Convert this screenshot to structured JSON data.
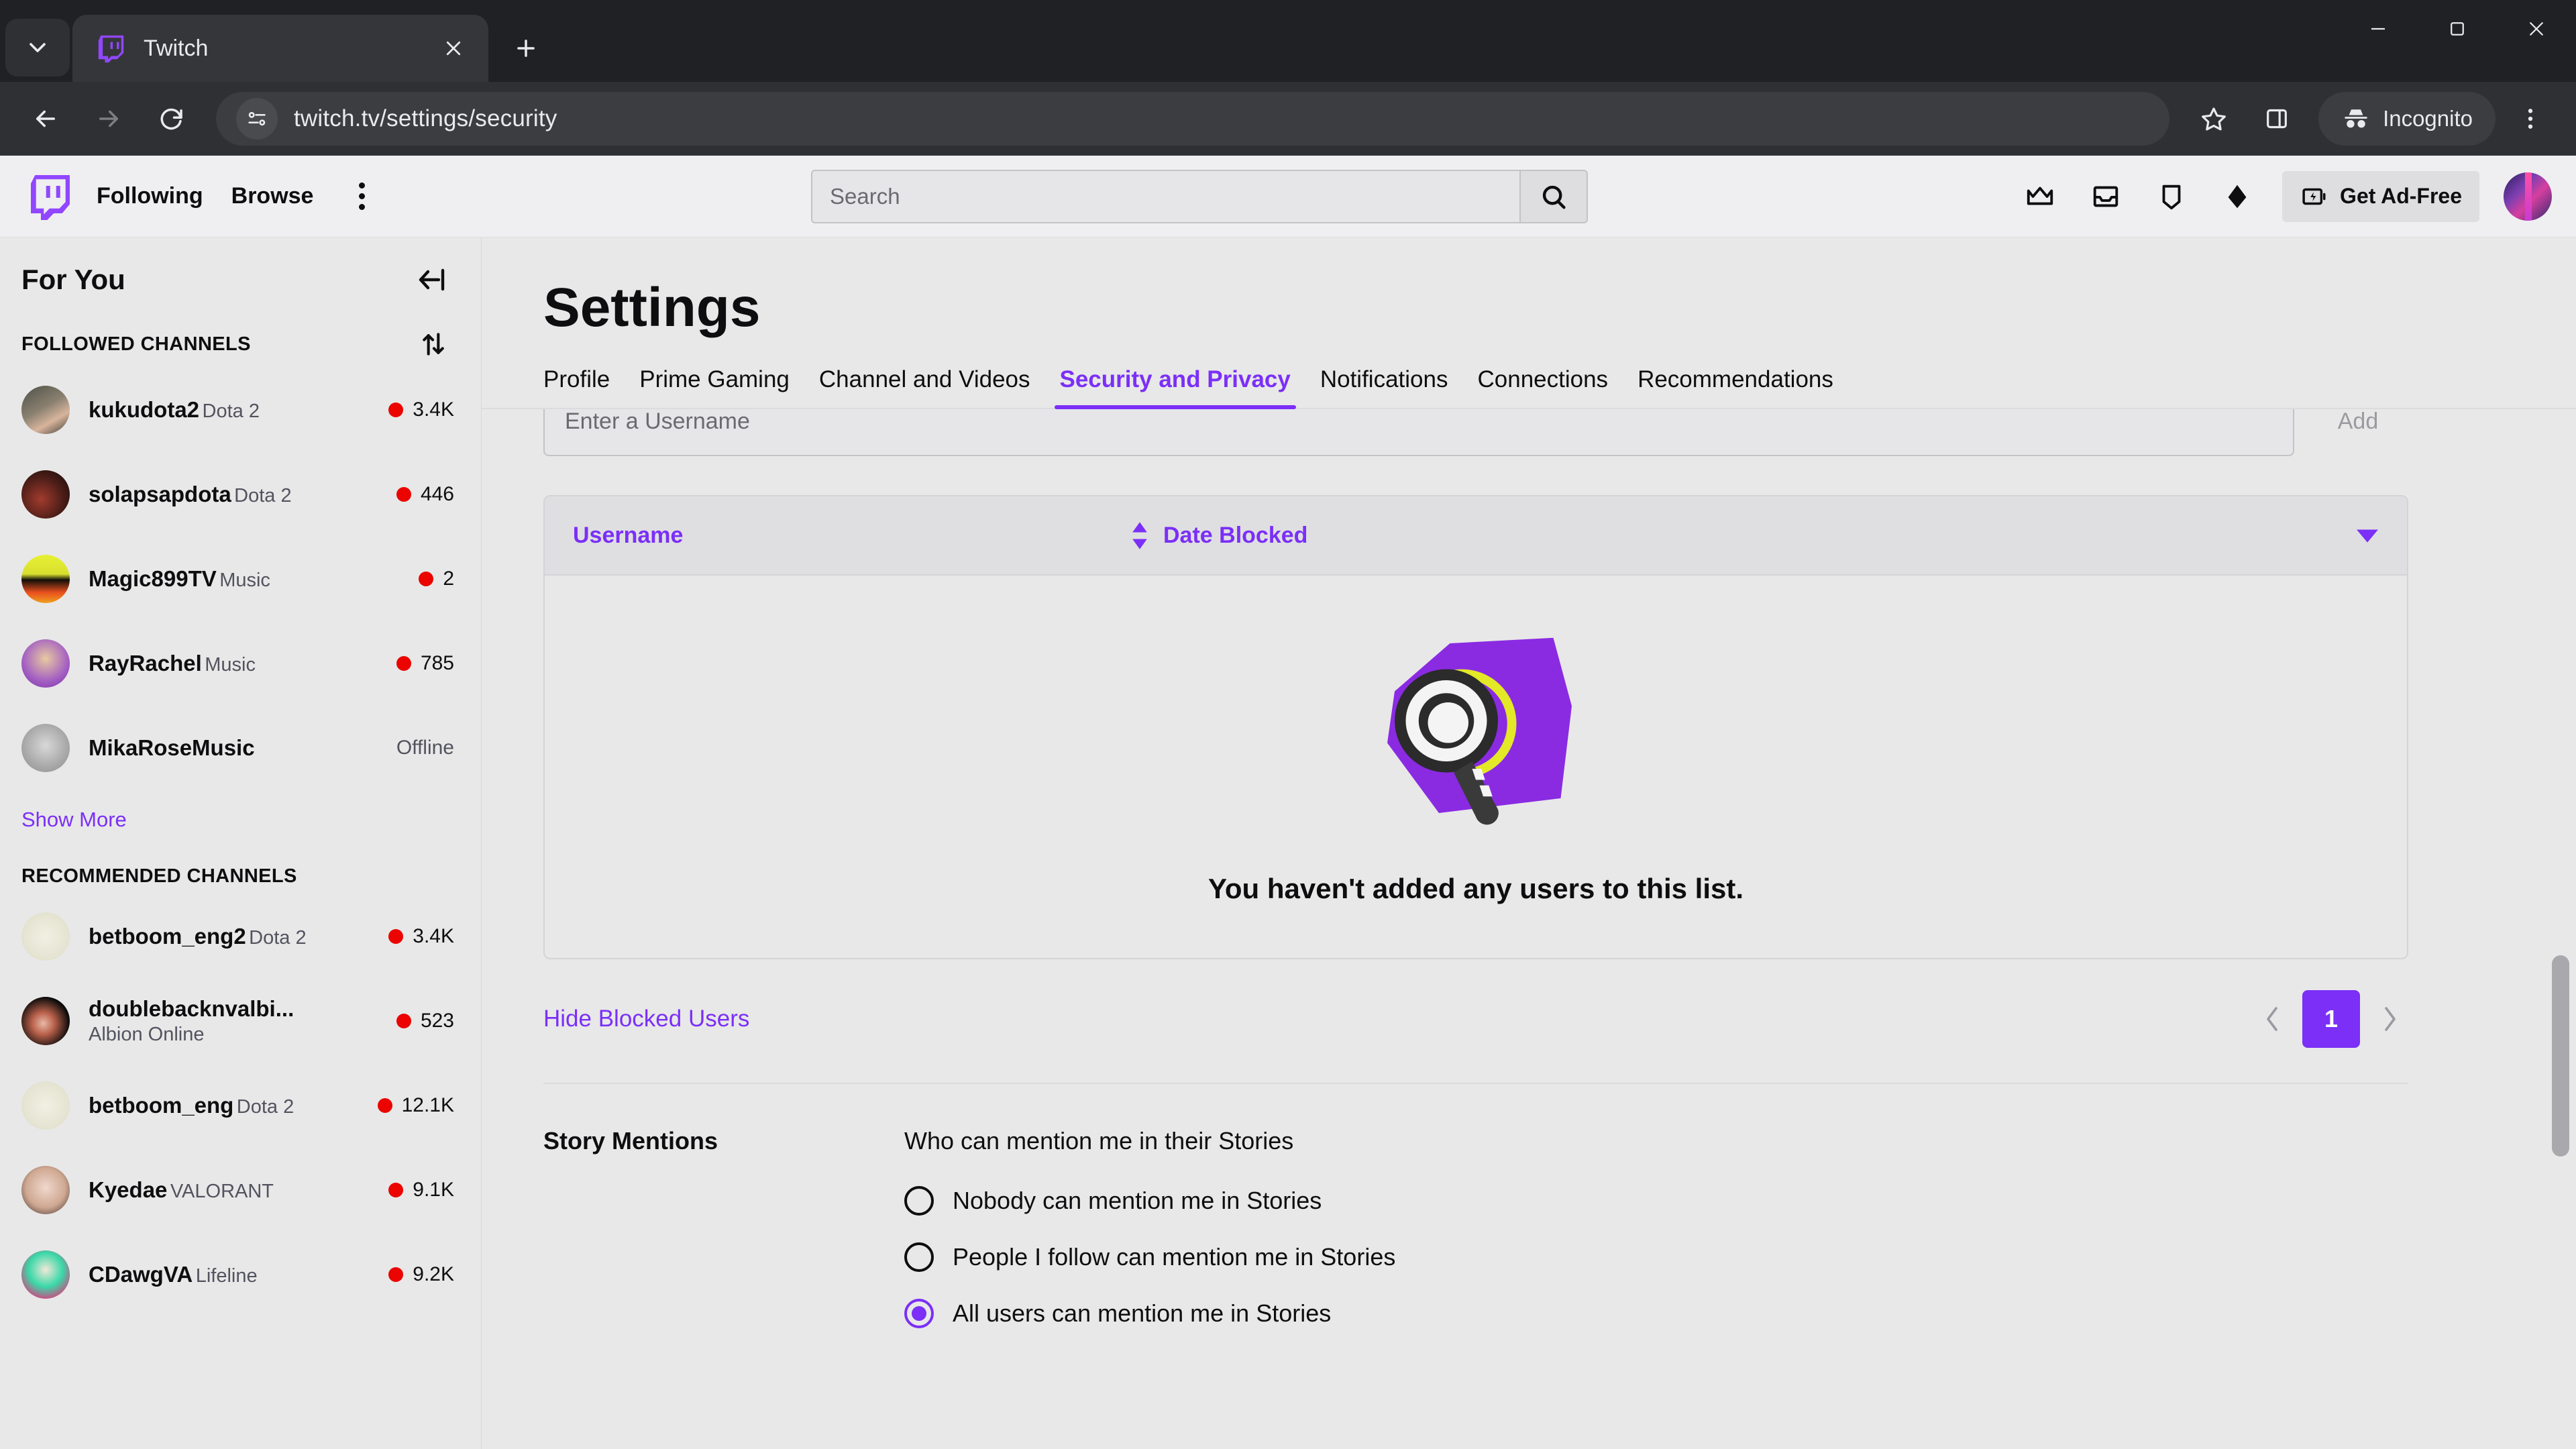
{
  "browser": {
    "tab": {
      "title": "Twitch",
      "favicon": "twitch-favicon"
    },
    "tab_search_label": "Search tabs",
    "new_tab_label": "New Tab",
    "window": {
      "minimize": "Minimize",
      "maximize": "Maximize",
      "close": "Close"
    },
    "nav": {
      "back": "Back",
      "forward": "Forward",
      "reload": "Reload"
    },
    "omnibox": {
      "url": "twitch.tv/settings/security",
      "site_info": "site-info-icon"
    },
    "actions": {
      "bookmark": "Bookmark this tab",
      "side_panel": "Side panel",
      "menu": "Customize and control"
    },
    "incognito_label": "Incognito"
  },
  "twitch_nav": {
    "logo": "twitch-logo",
    "links": [
      "Following",
      "Browse"
    ],
    "more_label": "More",
    "search": {
      "placeholder": "Search",
      "value": "",
      "button_label": "Search"
    },
    "icons": [
      "crown-icon",
      "inbox-icon",
      "whispers-icon",
      "bits-icon"
    ],
    "ad_free": {
      "label": "Get Ad-Free"
    },
    "avatar_label": "User avatar"
  },
  "sidebar": {
    "title": "For You",
    "collapse_label": "Collapse",
    "followed": {
      "heading": "FOLLOWED CHANNELS",
      "sort_label": "Sort",
      "channels": [
        {
          "name": "kukudota2",
          "category": "Dota 2",
          "viewers": "3.4K",
          "live": true,
          "status": ""
        },
        {
          "name": "solapsapdota",
          "category": "Dota 2",
          "viewers": "446",
          "live": true,
          "status": ""
        },
        {
          "name": "Magic899TV",
          "category": "Music",
          "viewers": "2",
          "live": true,
          "status": ""
        },
        {
          "name": "RayRachel",
          "category": "Music",
          "viewers": "785",
          "live": true,
          "status": ""
        },
        {
          "name": "MikaRoseMusic",
          "category": "",
          "viewers": "",
          "live": false,
          "status": "Offline"
        }
      ],
      "show_more": "Show More"
    },
    "recommended": {
      "heading": "RECOMMENDED CHANNELS",
      "channels": [
        {
          "name": "betboom_eng2",
          "category": "Dota 2",
          "viewers": "3.4K",
          "live": true
        },
        {
          "name": "doublebacknvalbi...",
          "category": "Albion Online",
          "viewers": "523",
          "live": true
        },
        {
          "name": "betboom_eng",
          "category": "Dota 2",
          "viewers": "12.1K",
          "live": true
        },
        {
          "name": "Kyedae",
          "category": "VALORANT",
          "viewers": "9.1K",
          "live": true
        },
        {
          "name": "CDawgVA",
          "category": "Lifeline",
          "viewers": "9.2K",
          "live": true
        }
      ]
    }
  },
  "settings": {
    "title": "Settings",
    "tabs": [
      {
        "label": "Profile",
        "active": false
      },
      {
        "label": "Prime Gaming",
        "active": false
      },
      {
        "label": "Channel and Videos",
        "active": false
      },
      {
        "label": "Security and Privacy",
        "active": true
      },
      {
        "label": "Notifications",
        "active": false
      },
      {
        "label": "Connections",
        "active": false
      },
      {
        "label": "Recommendations",
        "active": false
      }
    ],
    "blocked_users": {
      "add_input": {
        "placeholder": "Enter a Username",
        "value": ""
      },
      "add_button": "Add",
      "columns": [
        {
          "label": "Username",
          "sort_icon": "sort-updown-icon"
        },
        {
          "label": "Date Blocked",
          "sort_icon": "chevron-down-icon"
        }
      ],
      "rows": [],
      "empty_message": "You haven't added any users to this list.",
      "empty_illustration": "magnifying-glass-illustration",
      "hide_blocked_link": "Hide Blocked Users",
      "pagination": {
        "prev": "‹",
        "next": "›",
        "current_page": "1"
      }
    },
    "story_mentions": {
      "label": "Story Mentions",
      "question": "Who can mention me in their Stories",
      "options": [
        {
          "label": "Nobody can mention me in Stories",
          "selected": false
        },
        {
          "label": "People I follow can mention me in Stories",
          "selected": false
        },
        {
          "label": "All users can mention me in Stories",
          "selected": true
        }
      ]
    }
  },
  "colors": {
    "twitch_purple": "#7b2ff7",
    "live_red": "#eb0400",
    "page_bg": "#e8e8e8",
    "chrome_dark": "#2f3033"
  }
}
